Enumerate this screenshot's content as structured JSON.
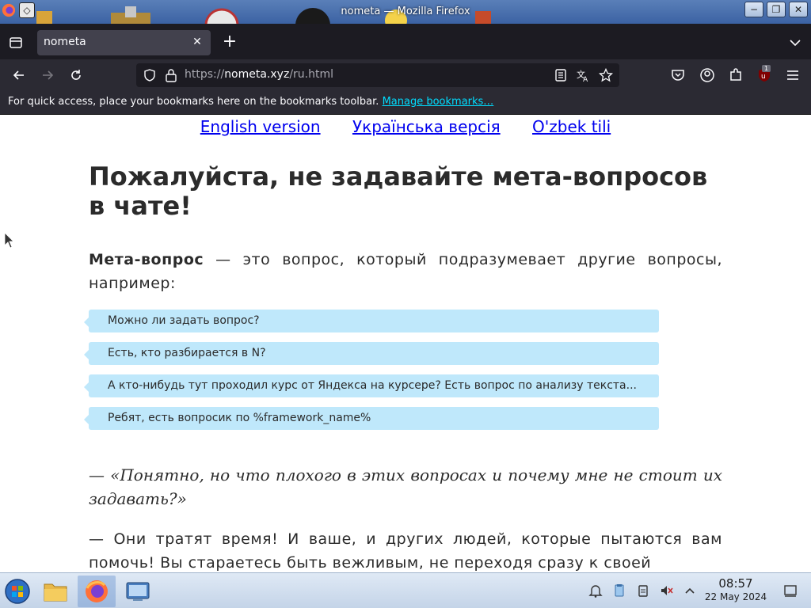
{
  "window": {
    "title": "nometa — Mozilla Firefox"
  },
  "tabs": [
    {
      "label": "nometa"
    }
  ],
  "navbar": {
    "url_prefix": "https://",
    "url_domain": "nometa.xyz",
    "url_path": "/ru.html",
    "extension_badge": "1"
  },
  "bookmarks": {
    "message": "For quick access, place your bookmarks here on the bookmarks toolbar.",
    "manage_link": "Manage bookmarks…"
  },
  "page": {
    "languages": [
      "English version",
      "Українська версія",
      "O'zbek tili"
    ],
    "heading": "Пожалуйста, не задавайте мета-вопросов в чате!",
    "intro_bold": "Мета-вопрос",
    "intro_rest": " — это вопрос, который подразумевает другие вопросы, например:",
    "examples": [
      "Можно ли задать вопрос?",
      "Есть, кто разбирается в N?",
      "А кто-нибудь тут проходил курс от Яндекса на курсере? Есть вопрос по анализу текста...",
      "Ребят, есть вопросик по %framework_name%"
    ],
    "quote": "— «Понятно, но что плохого в этих вопросах и почему мне не стоит их задавать?»",
    "answer": "— Они тратят время! И ваше, и других людей, которые пытаются вам помочь! Вы стараетесь быть вежливым, не переходя сразу к своей"
  },
  "taskbar": {
    "time": "08:57",
    "date": "22 May 2024"
  },
  "colors": {
    "link": "#0000ee",
    "example_bg": "#bfe8fb",
    "toolbar_bg": "#2b2a33",
    "tabstrip_bg": "#1c1b22"
  }
}
